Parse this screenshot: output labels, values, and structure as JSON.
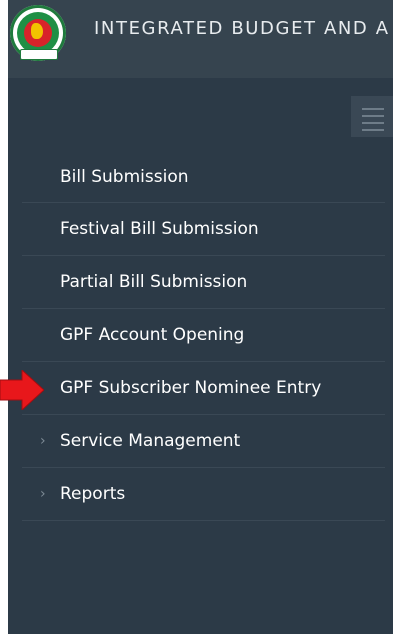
{
  "header": {
    "title": "INTEGRATED BUDGET AND A",
    "logo_icon": "bangladesh-emblem-icon"
  },
  "menu": {
    "toggle_icon": "hamburger-icon",
    "items": [
      {
        "label": "Bill Submission",
        "has_children": false
      },
      {
        "label": "Festival Bill Submission",
        "has_children": false
      },
      {
        "label": "Partial Bill Submission",
        "has_children": false
      },
      {
        "label": "GPF Account Opening",
        "has_children": false
      },
      {
        "label": "GPF Subscriber Nominee Entry",
        "has_children": false
      },
      {
        "label": "Service Management",
        "has_children": true,
        "chevron_icon": "chevron-right-icon"
      },
      {
        "label": "Reports",
        "has_children": true,
        "chevron_icon": "chevron-right-icon"
      }
    ]
  },
  "annotation": {
    "arrow_icon": "red-pointer-arrow-icon",
    "arrow_color": "#e8171b"
  },
  "colors": {
    "sidebar_bg": "#2c3a47",
    "header_bg": "#36444f",
    "text": "#ffffff"
  }
}
